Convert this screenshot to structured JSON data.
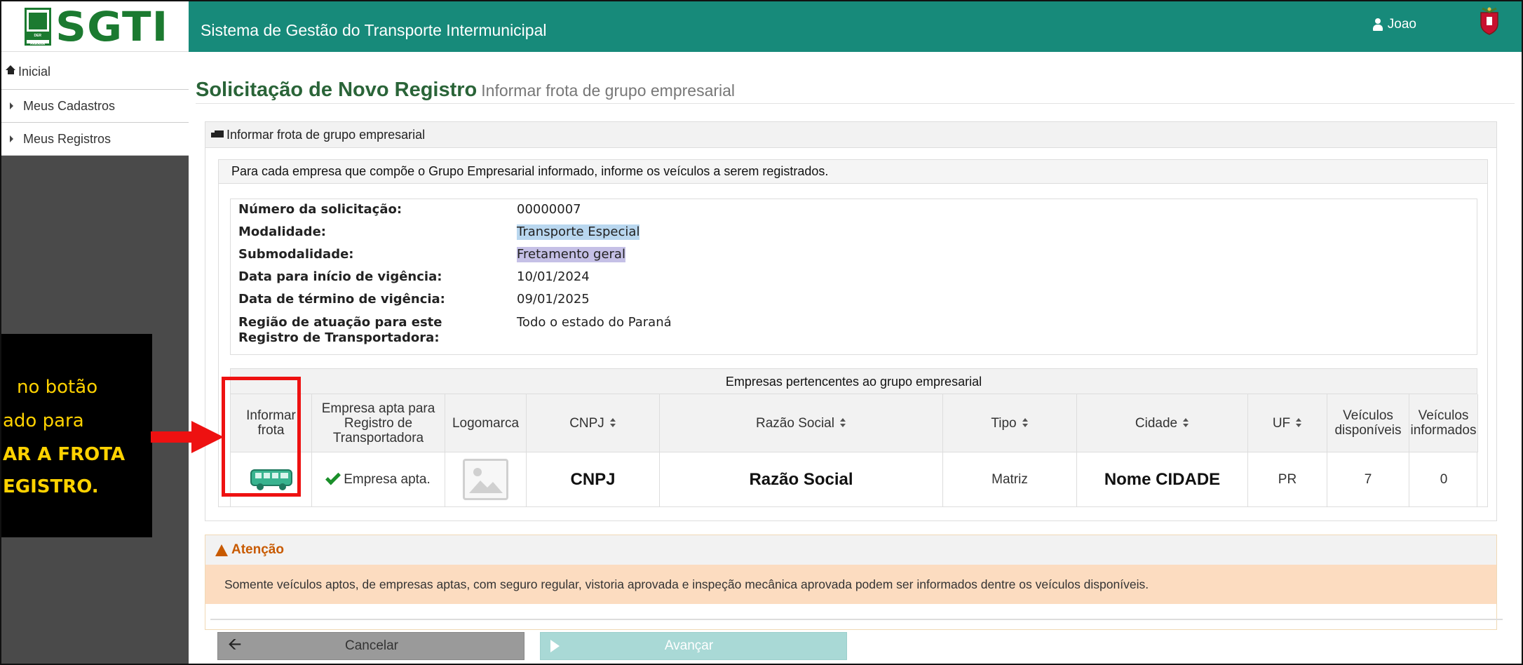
{
  "header": {
    "logo_text": "SGTI",
    "logo_badge_text": "DER PARANÁ",
    "app_title": "Sistema de Gestão do Transporte Intermunicipal",
    "user_name": "Joao"
  },
  "sidebar": {
    "items": [
      {
        "label": "Inicial",
        "icon": "home-icon"
      },
      {
        "label": "Meus Cadastros",
        "icon": "caret-right-icon"
      },
      {
        "label": "Meus Registros",
        "icon": "caret-right-icon"
      }
    ]
  },
  "page": {
    "title": "Solicitação de Novo Registro",
    "subtitle": "Informar frota de grupo empresarial"
  },
  "panel": {
    "heading": "Informar frota de grupo empresarial",
    "instructions": "Para cada empresa que compõe o Grupo Empresarial informado, informe os veículos a serem registrados."
  },
  "info": [
    {
      "label": "Número da solicitação:",
      "value": "00000007"
    },
    {
      "label": "Modalidade:",
      "value": "Transporte Especial"
    },
    {
      "label": "Submodalidade:",
      "value": "Fretamento geral"
    },
    {
      "label": "Data para início de vigência:",
      "value": "10/01/2024"
    },
    {
      "label": "Data de término de vigência:",
      "value": "09/01/2025"
    },
    {
      "label": "Região de atuação para este",
      "label2": "Registro de Transportadora:",
      "value": "Todo o estado do Paraná"
    }
  ],
  "table": {
    "caption": "Empresas pertencentes ao grupo empresarial",
    "headers": [
      {
        "l1": "Informar",
        "l2": "frota",
        "l3": ""
      },
      {
        "l1": "Empresa apta para",
        "l2": "Registro de",
        "l3": "Transportadora"
      },
      {
        "l1": "Logomarca",
        "l2": "",
        "l3": ""
      },
      {
        "l1": "CNPJ",
        "l2": "",
        "l3": ""
      },
      {
        "l1": "Razão Social",
        "l2": "",
        "l3": ""
      },
      {
        "l1": "Tipo",
        "l2": "",
        "l3": ""
      },
      {
        "l1": "Cidade",
        "l2": "",
        "l3": ""
      },
      {
        "l1": "UF",
        "l2": "",
        "l3": ""
      },
      {
        "l1": "Veículos",
        "l2": "disponíveis",
        "l3": ""
      },
      {
        "l1": "Veículos",
        "l2": "informados",
        "l3": ""
      }
    ],
    "row": {
      "apta": "Empresa apta.",
      "cnpj": "CNPJ",
      "razao_social": "Razão Social",
      "tipo": "Matriz",
      "cidade": "Nome CIDADE",
      "uf": "PR",
      "veiculos_disponiveis": "7",
      "veiculos_informados": "0"
    }
  },
  "alert": {
    "title": "Atenção",
    "message": "Somente veículos aptos, de empresas aptas, com seguro regular, vistoria aprovada e inspeção mecânica aprovada podem ser informados dentre os veículos disponíveis."
  },
  "buttons": {
    "cancel": "Cancelar",
    "next": "Avançar"
  },
  "callout": {
    "line1": "no botão",
    "line2": "ado para",
    "line3": "AR A FROTA",
    "line4": "EGISTRO."
  },
  "colors": {
    "topbar": "#178a7a",
    "brand_green": "#1b7a30",
    "title_green": "#2a6438",
    "alert_bg": "#fcdcc0",
    "alert_title": "#c85a00",
    "highlight_red": "#ee1111",
    "callout_text": "#ffd200"
  }
}
